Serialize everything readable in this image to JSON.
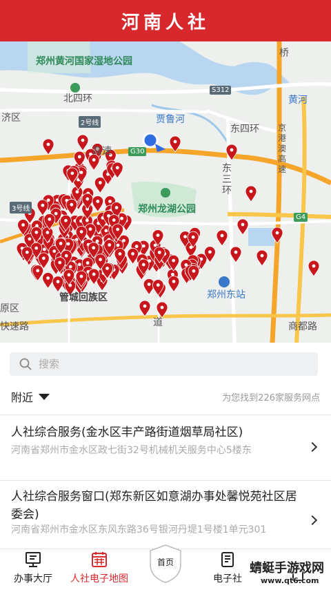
{
  "header": {
    "title": "河南人社"
  },
  "map": {
    "labels": {
      "wetland": "郑州黄河国家湿地公园",
      "beisihuan": "北四环",
      "jiqu": "济区",
      "line2": "2号线",
      "jialuhe": "贾鲁河",
      "dongsihuan": "东四环",
      "gaosu": "高速",
      "g30": "G30",
      "dongsanhuan": "东三环",
      "s312": "S312",
      "huang": "黄河",
      "jinggang": "京港澳高速",
      "qiao": "桥",
      "line3": "3号线",
      "longhu": "郑州龙湖公园",
      "g4": "G4",
      "guancheng": "管城回族区",
      "dongzhan": "郑州东站",
      "yuanqu": "原区",
      "dao": "道",
      "kuaisulu": "快速路",
      "shangdulu": "商都路"
    },
    "pin_count": 226,
    "pin_color": "#c8161d"
  },
  "search": {
    "placeholder": "搜索"
  },
  "filter": {
    "nearby_label": "附近",
    "found_text": "为您找到226家服务网点"
  },
  "list": [
    {
      "name": "人社综合服务(金水区丰产路街道烟草局社区)",
      "address": "河南省郑州市金水区政七街32号机械机关服务中心5楼东"
    },
    {
      "name": "人社综合服务窗口(郑东新区如意湖办事处馨悦苑社区居委会)",
      "address": "河南省郑州市金水区东风东路36号银河丹堤1号楼1单元301"
    }
  ],
  "tabbar": {
    "items": [
      {
        "label": "办事大厅",
        "icon": "monitor-icon"
      },
      {
        "label": "人社电子地图",
        "icon": "map-grid-icon"
      },
      {
        "label": "首页",
        "icon": "shield-icon"
      },
      {
        "label": "电子社",
        "icon": "card-icon"
      },
      {
        "label": "",
        "icon": "house-icon"
      }
    ],
    "active_color": "#d7282e"
  },
  "watermark": {
    "text": "蜻蜓手游戏网",
    "url": "www.qt6.com"
  }
}
